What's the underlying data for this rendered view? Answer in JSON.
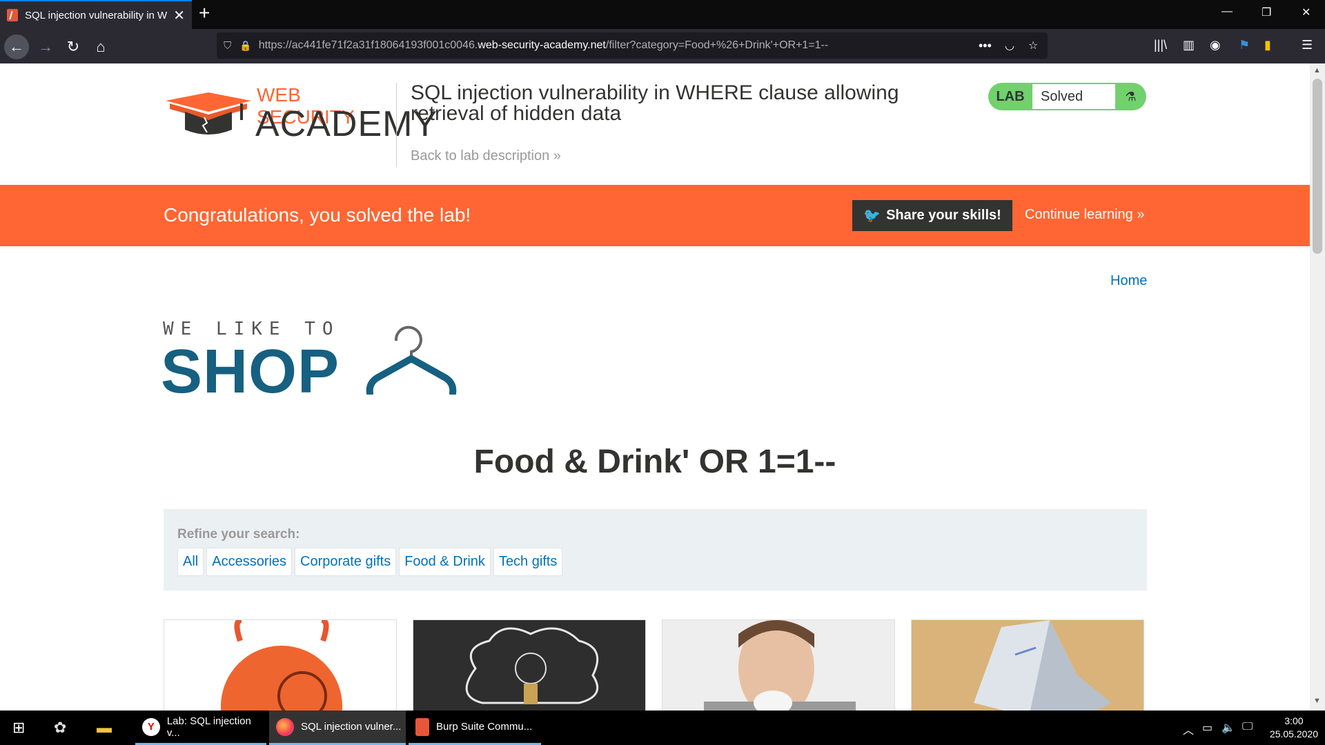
{
  "browser": {
    "tab_title": "SQL injection vulnerability in W",
    "url_prefix": "https://ac441fe71f2a31f18064193f001c0046.",
    "url_domain": "web-security-academy.net",
    "url_path": "/filter?category=Food+%26+Drink'+OR+1=1--"
  },
  "header": {
    "logo_line1": "WEB SECURITY",
    "logo_line2": "ACADEMY",
    "lab_title": "SQL injection vulnerability in WHERE clause allowing retrieval of hidden data",
    "back_link": "Back to lab description",
    "badge_lab": "LAB",
    "badge_status": "Solved"
  },
  "banner": {
    "message": "Congratulations, you solved the lab!",
    "share": "Share your skills!",
    "continue": "Continue learning"
  },
  "nav": {
    "home": "Home"
  },
  "shop_logo": {
    "line1": "WE LIKE TO",
    "line2": "SHOP"
  },
  "category_title": "Food & Drink' OR 1=1--",
  "filter": {
    "label": "Refine your search:",
    "links": [
      "All",
      "Accessories",
      "Corporate gifts",
      "Food & Drink",
      "Tech gifts"
    ]
  },
  "taskbar": {
    "items": [
      "Lab: SQL injection v...",
      "SQL injection vulner...",
      "Burp Suite Commu..."
    ],
    "time": "3:00",
    "date": "25.05.2020"
  },
  "colors": {
    "accent": "#ff6633",
    "link": "#0071bc",
    "badge": "#70d16d",
    "shop_blue": "#166081"
  }
}
